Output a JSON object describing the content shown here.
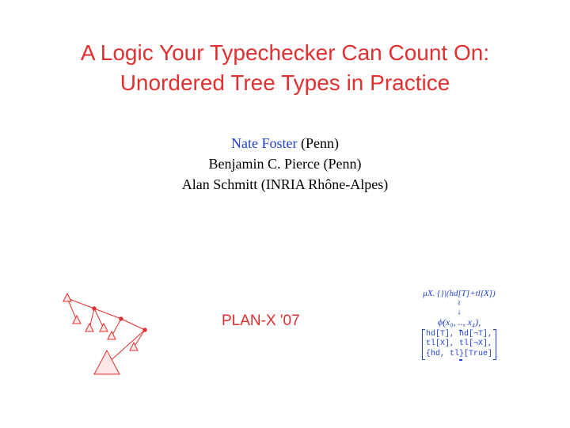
{
  "title": {
    "line1": "A Logic Your Typechecker Can Count On:",
    "line2": "Unordered Tree Types in Practice"
  },
  "authors": {
    "highlighted": "Nate Foster",
    "highlighted_affil": " (Penn)",
    "line2": "Benjamin C. Pierce (Penn)",
    "line3": "Alan Schmitt (INRIA Rhône-Alpes)"
  },
  "venue": "PLAN-X '07",
  "formula": {
    "mu": "μX. {}|(hd[T]+tl[X])",
    "phi": "ϕ(x₀, .., x₄),",
    "m1": "hd[T], hd[¬T],",
    "m2": "tl[X], tl[¬X],",
    "m3": "{hd, tl}[True]"
  }
}
